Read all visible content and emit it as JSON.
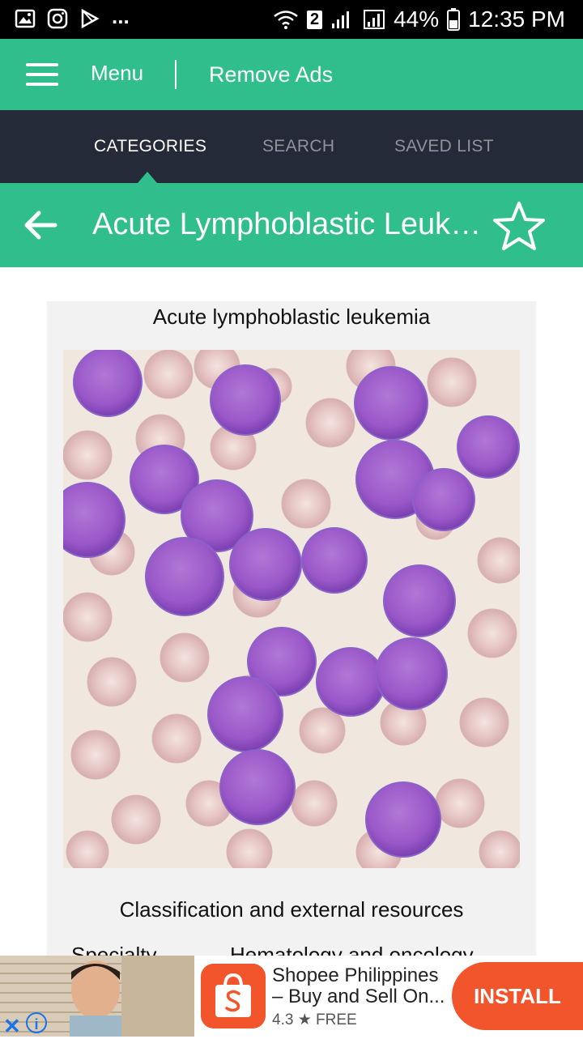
{
  "status_bar": {
    "left_overflow": "...",
    "sim_badge": "2",
    "battery": "44%",
    "time": "12:35 PM",
    "icons": [
      "gallery-icon",
      "instagram-icon",
      "play-store-icon",
      "wifi-icon",
      "signal-icon",
      "battery-icon"
    ]
  },
  "app_bar": {
    "menu_label": "Menu",
    "remove_ads_label": "Remove Ads",
    "color": "#30bf8c"
  },
  "tabs": [
    {
      "label": "CATEGORIES",
      "active": true
    },
    {
      "label": "SEARCH",
      "active": false
    },
    {
      "label": "SAVED LIST",
      "active": false
    }
  ],
  "title_bar": {
    "title": "Acute Lymphoblastic Leukemia",
    "icons": [
      "back-arrow-icon",
      "star-outline-icon"
    ]
  },
  "article": {
    "image_caption": "Acute lymphoblastic leukemia",
    "classification_heading": "Classification and external resources",
    "specialty_label": "Specialty",
    "specialty_value": "Hematology and oncology"
  },
  "ad": {
    "app_name": "Shopee Philippines – Buy and Sell On...",
    "rating": "4.3",
    "price": "FREE",
    "install_label": "INSTALL",
    "close_label": "✕",
    "info_label": "i",
    "accent": "#f2552c"
  }
}
